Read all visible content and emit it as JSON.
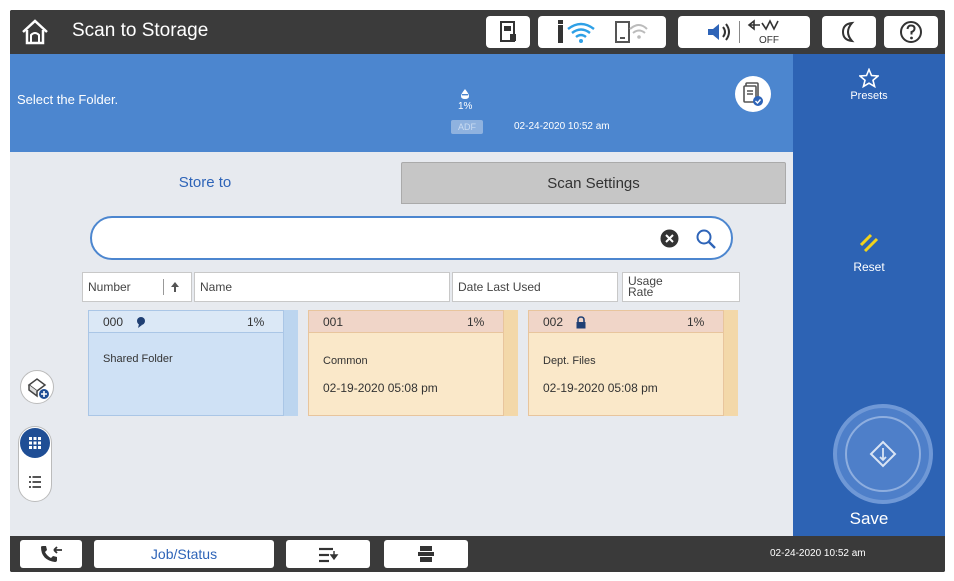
{
  "topbar": {
    "title": "Scan to Storage",
    "icons": [
      "home-icon",
      "device-status-icon",
      "wifi-icon",
      "wifi-direct-icon",
      "sound-icon",
      "scan-off-icon",
      "sleep-moon-icon",
      "help-icon"
    ],
    "off_label": "OFF"
  },
  "header": {
    "instruction": "Select the Folder.",
    "ink_level": "1%",
    "adf_label": "ADF",
    "datetime": "02-24-2020 10:52 am"
  },
  "tabs": [
    {
      "label": "Store to",
      "active": true
    },
    {
      "label": "Scan Settings",
      "active": false
    }
  ],
  "search": {
    "value": "",
    "placeholder": ""
  },
  "columns": {
    "number": "Number",
    "name": "Name",
    "date": "Date Last Used",
    "usage": "Usage Rate"
  },
  "folders": [
    {
      "number": "000",
      "usage": "1%",
      "name": "Shared Folder",
      "date": "",
      "locked": false,
      "shared": true
    },
    {
      "number": "001",
      "usage": "1%",
      "name": "Common",
      "date": "02-19-2020 05:08 pm",
      "locked": false,
      "shared": false
    },
    {
      "number": "002",
      "usage": "1%",
      "name": "Dept. Files",
      "date": "02-19-2020 05:08 pm",
      "locked": true,
      "shared": false
    }
  ],
  "right_panel": {
    "presets_label": "Presets",
    "reset_label": "Reset",
    "save_label": "Save"
  },
  "bottombar": {
    "job_status_label": "Job/Status",
    "datetime": "02-24-2020 10:52 am"
  },
  "colors": {
    "header_blue": "#4c86cf",
    "right_panel_blue": "#2d63b4",
    "accent_text": "#2e64b8",
    "reset_yellow": "#f2d31b"
  }
}
